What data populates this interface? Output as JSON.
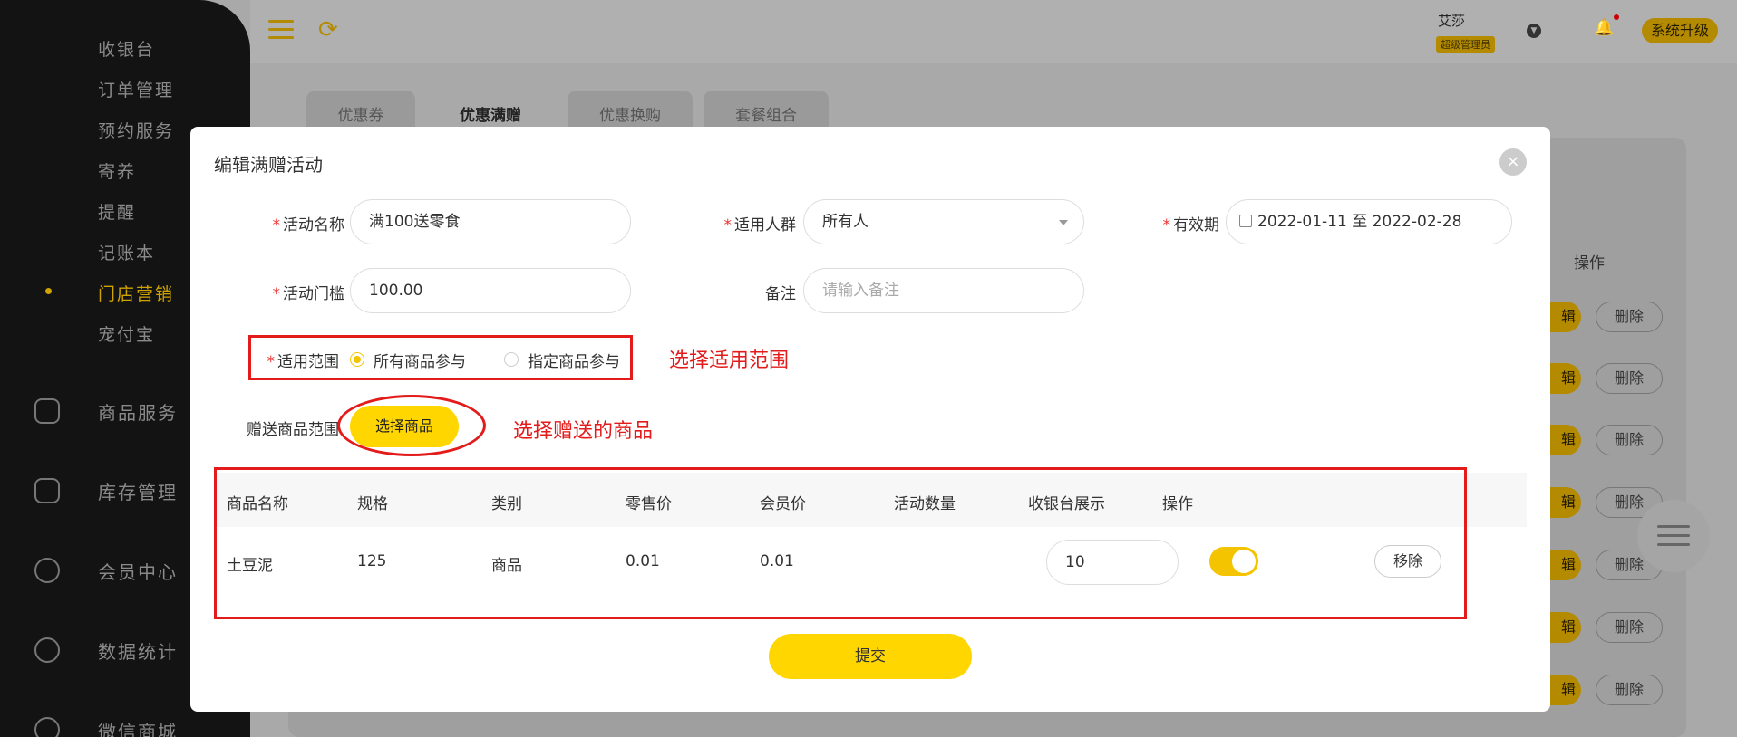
{
  "sidebar": {
    "sub_items": [
      {
        "label": "收银台"
      },
      {
        "label": "订单管理"
      },
      {
        "label": "预约服务"
      },
      {
        "label": "寄养"
      },
      {
        "label": "提醒"
      },
      {
        "label": "记账本"
      },
      {
        "label": "门店营销",
        "active": true
      },
      {
        "label": "宠付宝"
      }
    ],
    "main_items": [
      {
        "label": "商品服务",
        "icon": "shopping-bag-icon"
      },
      {
        "label": "库存管理",
        "icon": "box-icon"
      },
      {
        "label": "会员中心",
        "icon": "member-icon"
      },
      {
        "label": "数据统计",
        "icon": "chart-icon"
      },
      {
        "label": "微信商城",
        "icon": "wechat-icon"
      }
    ]
  },
  "topbar": {
    "user_name": "艾莎",
    "user_role": "超级管理员",
    "upgrade_label": "系统升级"
  },
  "bg": {
    "tabs": [
      "优惠券",
      "优惠满赠",
      "优惠换购",
      "套餐组合"
    ],
    "active_tab": "优惠满赠",
    "op_header": "操作",
    "edit_label": "辑",
    "delete_label": "删除"
  },
  "modal": {
    "title": "编辑满赠活动",
    "close_icon": "×",
    "fields": {
      "name_label": "活动名称",
      "name_value": "满100送零食",
      "audience_label": "适用人群",
      "audience_value": "所有人",
      "validity_label": "有效期",
      "validity_value": "2022-01-11 至 2022-02-28",
      "threshold_label": "活动门槛",
      "threshold_value": "100.00",
      "remark_label": "备注",
      "remark_placeholder": "请输入备注",
      "scope_label": "适用范围",
      "scope_option_all": "所有商品参与",
      "scope_option_specified": "指定商品参与",
      "gift_label": "赠送商品范围",
      "pick_button": "选择商品"
    },
    "table": {
      "headers": [
        "商品名称",
        "规格",
        "类别",
        "零售价",
        "会员价",
        "活动数量",
        "收银台展示",
        "操作"
      ],
      "rows": [
        {
          "name": "土豆泥",
          "spec": "125",
          "category": "商品",
          "retail": "0.01",
          "member": "0.01",
          "qty": "10",
          "show_at_pos": true,
          "action": "移除"
        }
      ]
    },
    "submit_label": "提交"
  },
  "annotations": {
    "scope_note": "选择适用范围",
    "gift_note": "选择赠送的商品"
  },
  "colors": {
    "accent": "#ffd600",
    "annotation": "#e31b1b"
  }
}
